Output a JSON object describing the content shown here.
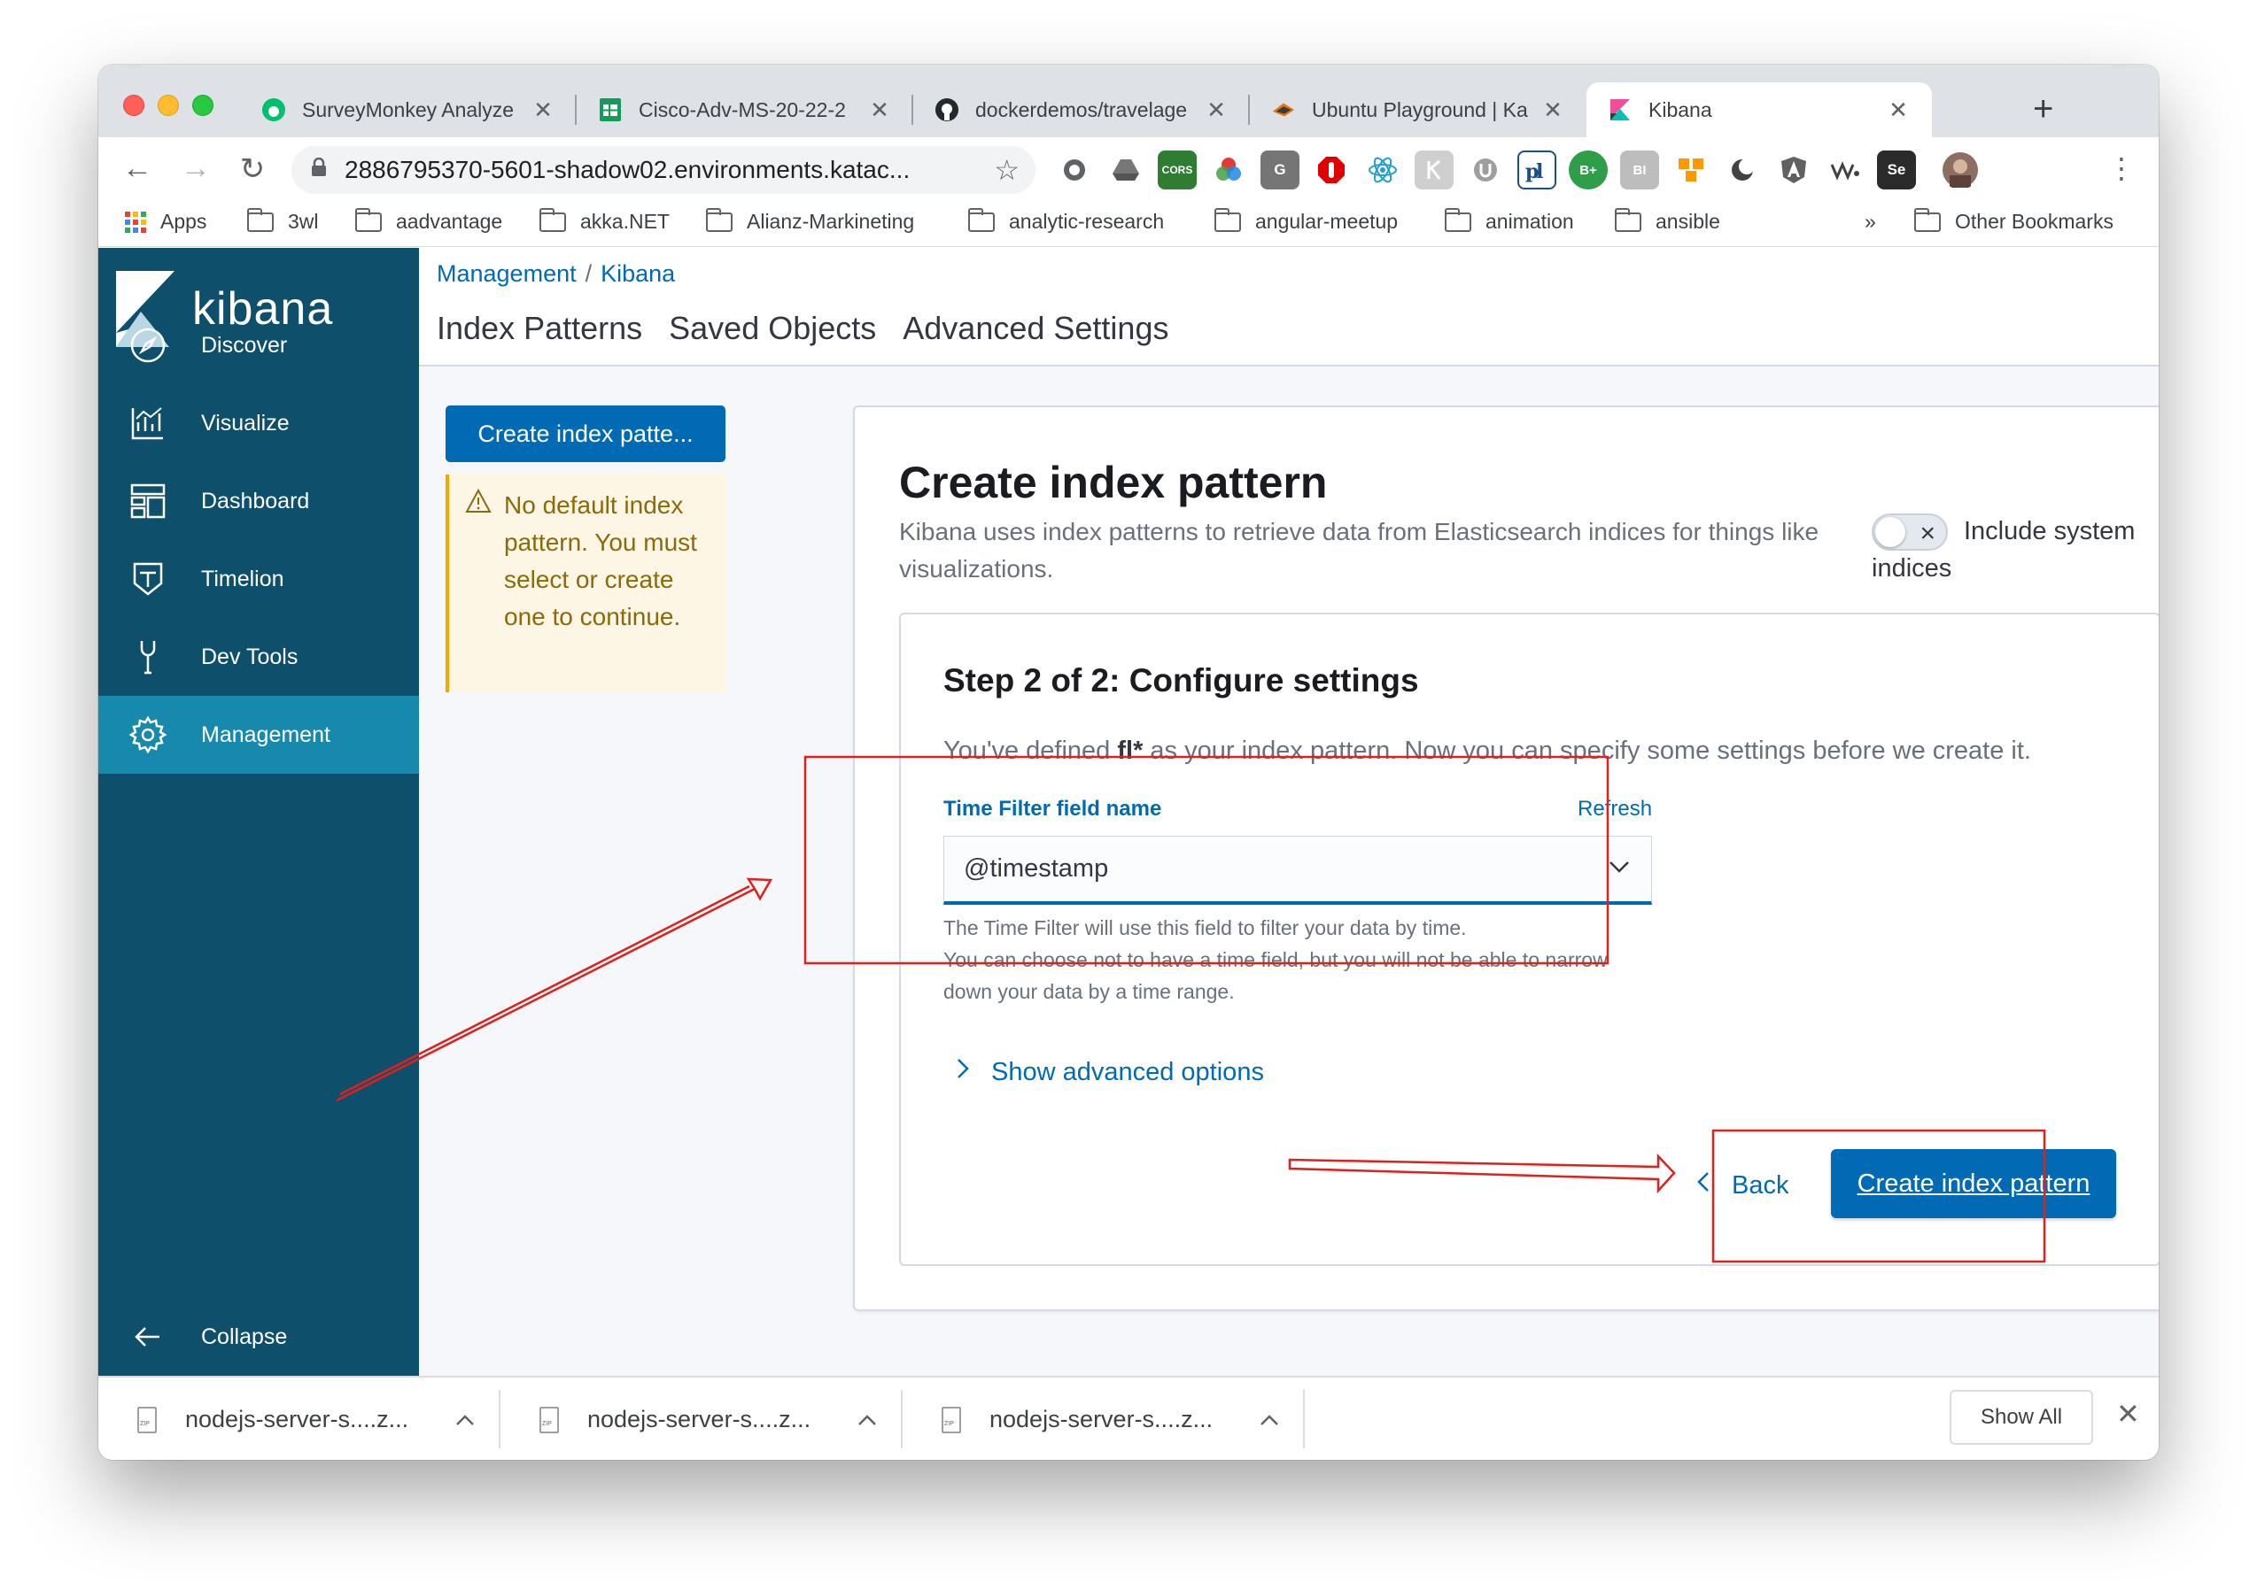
{
  "browser": {
    "tabs": [
      {
        "title": "SurveyMonkey Analyze",
        "icon": "surveymonkey-icon"
      },
      {
        "title": "Cisco-Adv-MS-20-22-2",
        "icon": "google-sheets-icon"
      },
      {
        "title": "dockerdemos/travelage",
        "icon": "github-icon"
      },
      {
        "title": "Ubuntu Playground | Ka",
        "icon": "katacoda-icon"
      },
      {
        "title": "Kibana",
        "icon": "kibana-icon"
      }
    ],
    "new_tab": "+",
    "close": "✕",
    "url": "2886795370-5601-shadow02.environments.katac...",
    "ext_labels": {
      "cors": "CORS",
      "bplus": "B+",
      "bi": "BI",
      "se": "Se",
      "g": "G"
    },
    "bookmarks": {
      "apps": "Apps",
      "folders": [
        "3wl",
        "aadvantage",
        "akka.NET",
        "Alianz-Markineting",
        "analytic-research",
        "angular-meetup",
        "animation",
        "ansible"
      ],
      "overflow": "»",
      "other": "Other Bookmarks"
    }
  },
  "kibana": {
    "logo": "kibana",
    "nav": [
      {
        "label": "Discover",
        "icon": "compass-icon"
      },
      {
        "label": "Visualize",
        "icon": "chart-icon"
      },
      {
        "label": "Dashboard",
        "icon": "dashboard-icon"
      },
      {
        "label": "Timelion",
        "icon": "timelion-icon"
      },
      {
        "label": "Dev Tools",
        "icon": "wrench-icon"
      },
      {
        "label": "Management",
        "icon": "gear-icon",
        "active": true
      }
    ],
    "collapse": "Collapse",
    "breadcrumbs": [
      "Management",
      "Kibana"
    ],
    "breadcrumb_sep": "/",
    "subtabs": [
      "Index Patterns",
      "Saved Objects",
      "Advanced Settings"
    ],
    "create_button": "Create index patte...",
    "callout": "No default index pattern. You must select or create one to continue.",
    "panel": {
      "title": "Create index pattern",
      "description": "Kibana uses index patterns to retrieve data from Elasticsearch indices for things like visualizations.",
      "toggle_label": "Include system indices",
      "toggle_on": false,
      "step_title": "Step 2 of 2: Configure settings",
      "defined_prefix": "You've defined ",
      "defined_pattern": "fl*",
      "defined_suffix": " as your index pattern. Now you can specify some settings before we create it.",
      "field_label": "Time Filter field name",
      "refresh": "Refresh",
      "field_value": "@timestamp",
      "help_1": "The Time Filter will use this field to filter your data by time.",
      "help_2": "You can choose not to have a time field, but you will not be able to narrow down your data by a time range.",
      "advanced": "Show advanced options",
      "back": "Back",
      "submit": "Create index pattern"
    }
  },
  "downloads": {
    "items": [
      "nodejs-server-s....z...",
      "nodejs-server-s....z...",
      "nodejs-server-s....z..."
    ],
    "show_all": "Show All",
    "close": "✕"
  },
  "annotation_color": "#e0201b"
}
